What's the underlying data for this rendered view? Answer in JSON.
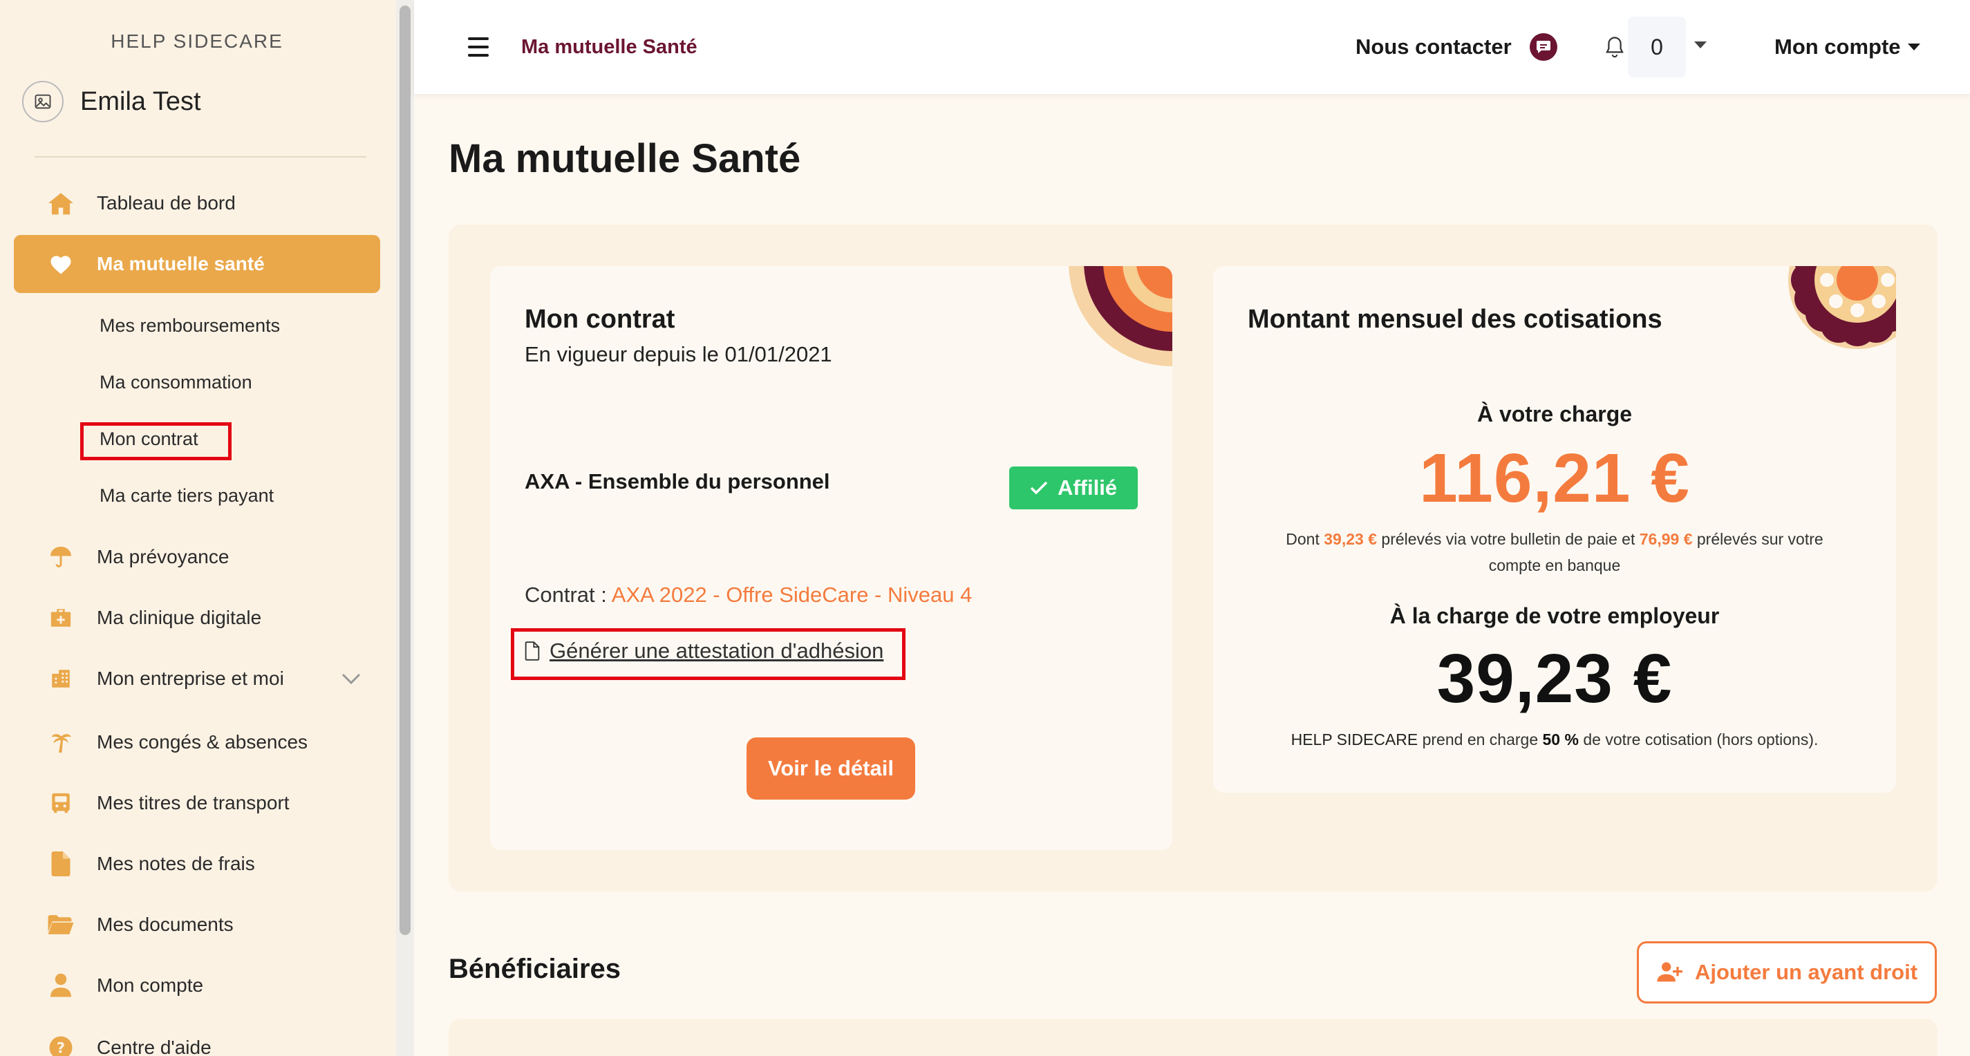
{
  "app": {
    "organization": "HELP SIDECARE",
    "user_name": "Emila Test"
  },
  "sidebar": {
    "items": [
      {
        "label": "Tableau de bord",
        "icon": "home-icon"
      },
      {
        "label": "Ma mutuelle santé",
        "icon": "heart-icon",
        "active": true
      },
      {
        "label": "Ma prévoyance",
        "icon": "umbrella-icon"
      },
      {
        "label": "Ma clinique digitale",
        "icon": "medical-kit-icon"
      },
      {
        "label": "Mon entreprise et moi",
        "icon": "building-icon"
      },
      {
        "label": "Mes congés & absences",
        "icon": "palm-tree-icon"
      },
      {
        "label": "Mes titres de transport",
        "icon": "bus-icon"
      },
      {
        "label": "Mes notes de frais",
        "icon": "file-icon"
      },
      {
        "label": "Mes documents",
        "icon": "folder-icon"
      },
      {
        "label": "Mon compte",
        "icon": "user-icon"
      },
      {
        "label": "Centre d'aide",
        "icon": "help-icon"
      }
    ],
    "subitems": [
      {
        "label": "Mes remboursements"
      },
      {
        "label": "Ma consommation"
      },
      {
        "label": "Mon contrat",
        "highlighted": true
      },
      {
        "label": "Ma carte tiers payant"
      }
    ]
  },
  "header": {
    "breadcrumb": "Ma mutuelle Santé",
    "contact_label": "Nous contacter",
    "notification_count": "0",
    "account_label": "Mon compte"
  },
  "page": {
    "title": "Ma mutuelle Santé"
  },
  "contract_card": {
    "title": "Mon contrat",
    "since": "En vigueur depuis le 01/01/2021",
    "plan": "AXA - Ensemble du personnel",
    "status_badge": "Affilié",
    "contract_label": "Contrat :",
    "contract_value": "AXA 2022 - Offre SideCare - Niveau 4",
    "generate_link": "Générer une attestation d'adhésion",
    "detail_button": "Voir le détail"
  },
  "contribution_card": {
    "title": "Montant mensuel des cotisations",
    "employee_heading": "À votre charge",
    "employee_amount": "116,21 €",
    "note_prefix": "Dont",
    "payroll_amount": "39,23 €",
    "note_mid": "prélevés via votre bulletin de paie et",
    "bank_amount": "76,99 €",
    "note_suffix": "prélevés sur votre",
    "note_line2": "compte en banque",
    "employer_heading": "À la charge de votre employeur",
    "employer_amount": "39,23 €",
    "employer_note_org": "HELP SIDECARE",
    "employer_note_mid": "prend en charge",
    "employer_percent": "50 %",
    "employer_note_end": "de votre cotisation (hors options)."
  },
  "beneficiaries": {
    "title": "Bénéficiaires",
    "add_button": "Ajouter un ayant droit"
  },
  "colors": {
    "accent_orange": "#f47b3e",
    "sidebar_active": "#eaa84a",
    "brand_burgundy": "#6b1532",
    "success_green": "#2ec66a",
    "highlight_red": "#e30613"
  }
}
